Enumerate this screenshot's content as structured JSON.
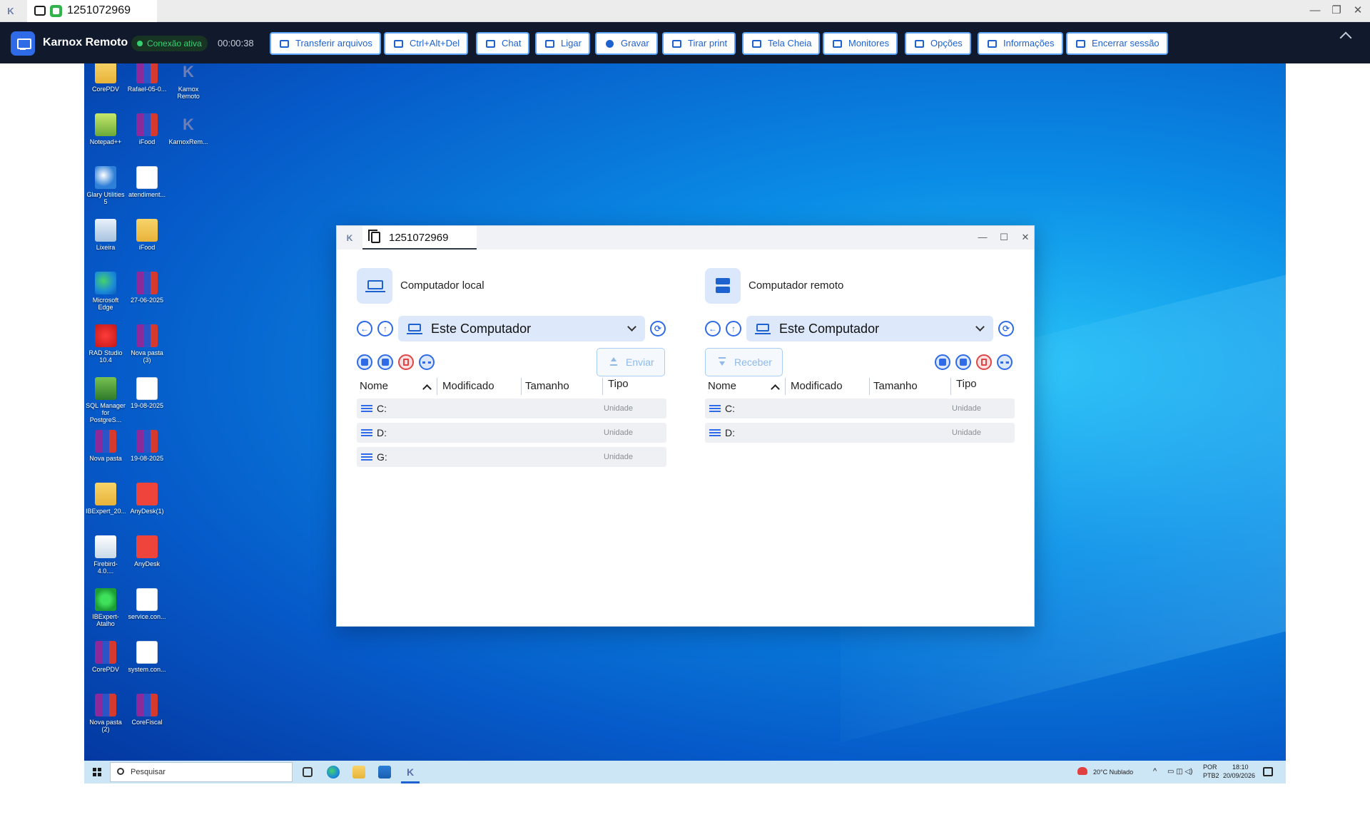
{
  "window": {
    "session_id": "1251072969",
    "controls": {
      "minimize": "—",
      "restore": "❐",
      "close": "✕"
    }
  },
  "toolbar": {
    "app_name": "Karnox Remoto",
    "status": "Conexão ativa",
    "timer": "00:00:38",
    "buttons": [
      {
        "label": "Transferir arquivos",
        "icon": "file-transfer-icon"
      },
      {
        "label": "Ctrl+Alt+Del",
        "icon": "keyboard-icon"
      },
      {
        "label": "Chat",
        "icon": "chat-icon"
      },
      {
        "label": "Ligar",
        "icon": "phone-icon"
      },
      {
        "label": "Gravar",
        "icon": "record-icon"
      },
      {
        "label": "Tirar print",
        "icon": "camera-icon"
      },
      {
        "label": "Tela Cheia",
        "icon": "fullscreen-icon"
      },
      {
        "label": "Monitores",
        "icon": "monitor-icon"
      },
      {
        "label": "Opções",
        "icon": "sliders-icon"
      },
      {
        "label": "Informações",
        "icon": "info-icon"
      },
      {
        "label": "Encerrar sessão",
        "icon": "logout-icon"
      }
    ],
    "colors": {
      "background": "#111a2c",
      "accent": "#1e62d0",
      "status": "#35d072"
    }
  },
  "desktop_icons": [
    {
      "label": "CorePDV",
      "glyph": "folder"
    },
    {
      "label": "Rafael-05-0...",
      "glyph": "rar"
    },
    {
      "label": "Karnox Remoto",
      "glyph": "karnox"
    },
    {
      "label": "Notepad++",
      "glyph": "np"
    },
    {
      "label": "iFood",
      "glyph": "rar"
    },
    {
      "label": "KarnoxRem...",
      "glyph": "karnox"
    },
    {
      "label": "Glary Utilities 5",
      "glyph": "glary"
    },
    {
      "label": "atendiment...",
      "glyph": "doc"
    },
    {
      "label": "Lixeira",
      "glyph": "bin"
    },
    {
      "label": "iFood",
      "glyph": "folder"
    },
    {
      "label": "Microsoft Edge",
      "glyph": "edge"
    },
    {
      "label": "27-06-2025",
      "glyph": "rar"
    },
    {
      "label": "RAD Studio 10.4",
      "glyph": "rad"
    },
    {
      "label": "Nova pasta (3)",
      "glyph": "rar"
    },
    {
      "label": "SQL Manager for PostgreS...",
      "glyph": "sql"
    },
    {
      "label": "19-08-2025",
      "glyph": "doc"
    },
    {
      "label": "Nova pasta",
      "glyph": "rar"
    },
    {
      "label": "19-08-2025",
      "glyph": "rar"
    },
    {
      "label": "IBExpert_20...",
      "glyph": "folder"
    },
    {
      "label": "AnyDesk(1)",
      "glyph": "any"
    },
    {
      "label": "Firebird-4.0....",
      "glyph": "fire"
    },
    {
      "label": "AnyDesk",
      "glyph": "any"
    },
    {
      "label": "IBExpert-Atalho",
      "glyph": "ibe"
    },
    {
      "label": "service.con...",
      "glyph": "doc"
    },
    {
      "label": "CorePDV",
      "glyph": "rar"
    },
    {
      "label": "system.con...",
      "glyph": "doc"
    },
    {
      "label": "Nova pasta (2)",
      "glyph": "rar"
    },
    {
      "label": "CoreFiscal",
      "glyph": "rar"
    }
  ],
  "taskbar": {
    "search_placeholder": "Pesquisar",
    "weather": "20°C  Nublado",
    "language": "POR",
    "layout": "PTB2",
    "time": "18:10",
    "date": "20/09/2026"
  },
  "file_transfer": {
    "tab_title": "1251072969",
    "local": {
      "title": "Computador local",
      "path": "Este Computador",
      "transfer_label": "Enviar",
      "columns": [
        "Nome",
        "Modificado",
        "Tamanho",
        "Tipo"
      ],
      "rows": [
        {
          "name": "C:",
          "type": "Unidade"
        },
        {
          "name": "D:",
          "type": "Unidade"
        },
        {
          "name": "G:",
          "type": "Unidade"
        }
      ]
    },
    "remote": {
      "title": "Computador remoto",
      "path": "Este Computador",
      "transfer_label": "Receber",
      "columns": [
        "Nome",
        "Modificado",
        "Tamanho",
        "Tipo"
      ],
      "rows": [
        {
          "name": "C:",
          "type": "Unidade"
        },
        {
          "name": "D:",
          "type": "Unidade"
        }
      ]
    }
  }
}
